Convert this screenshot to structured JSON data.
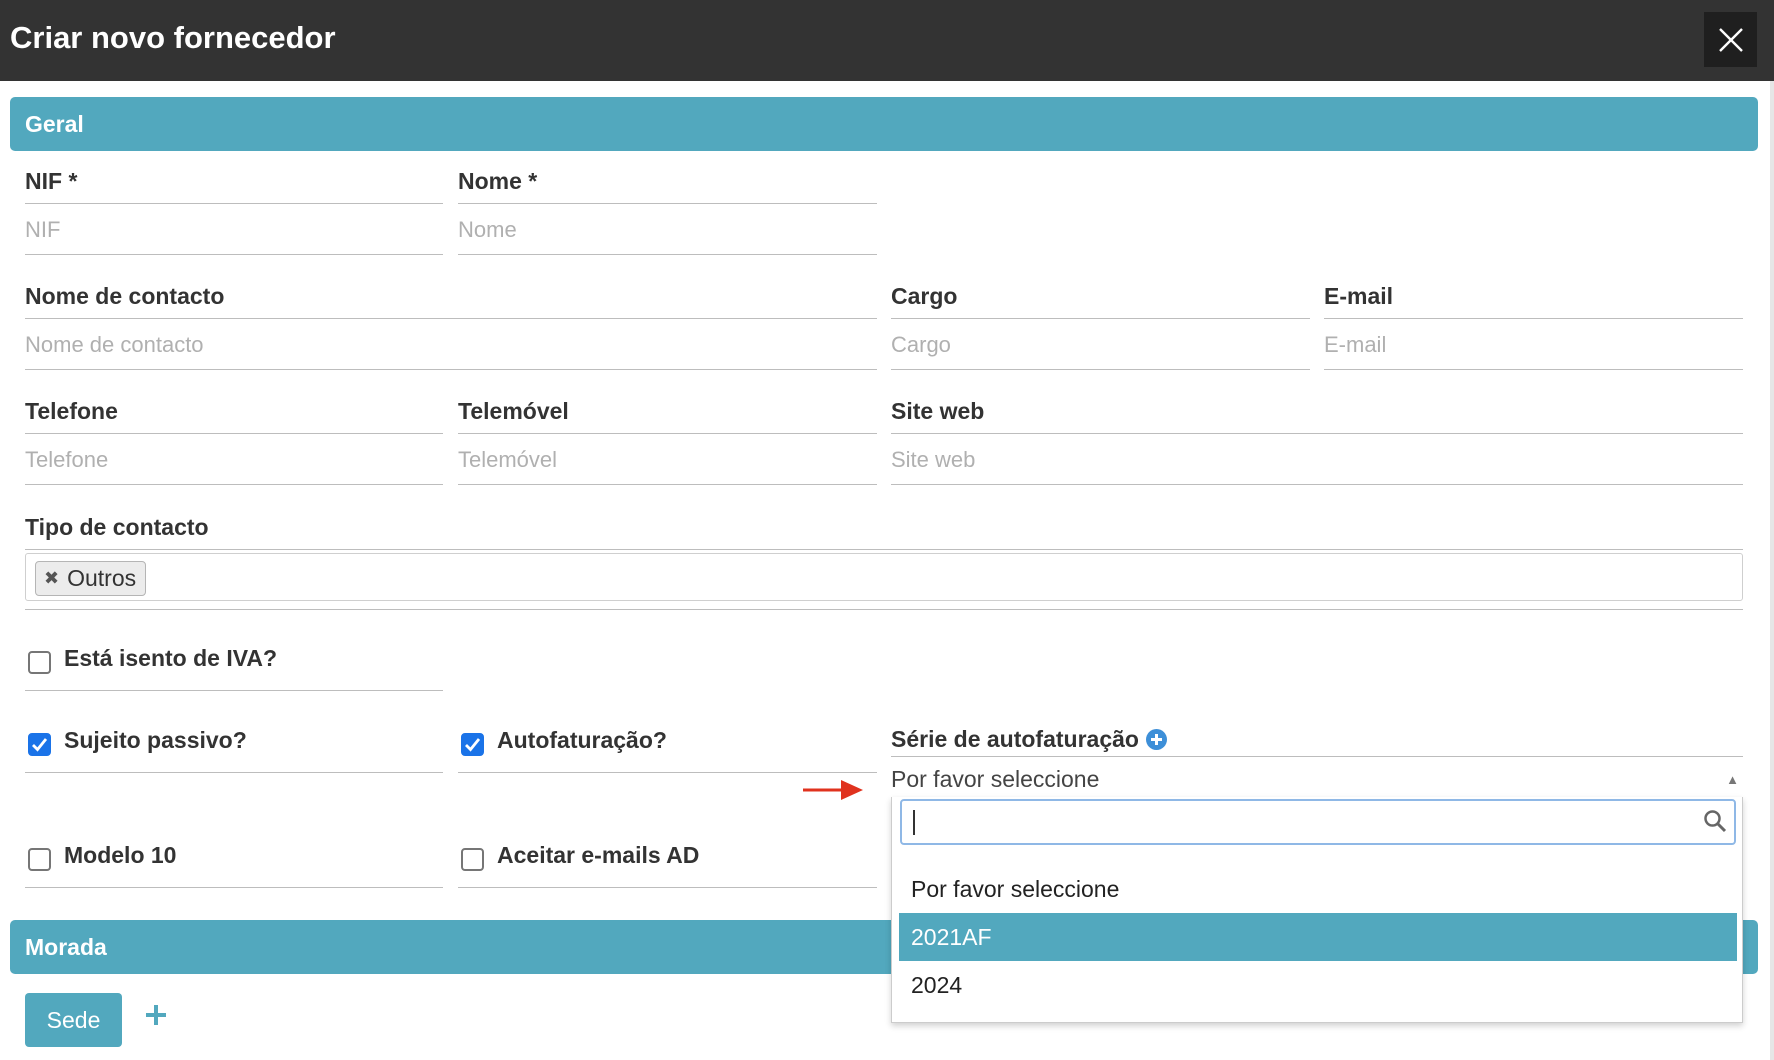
{
  "window": {
    "title": "Criar novo fornecedor"
  },
  "sections": {
    "geral": "Geral",
    "morada": "Morada"
  },
  "fields": {
    "nif": {
      "label": "NIF *",
      "placeholder": "NIF",
      "value": ""
    },
    "nome": {
      "label": "Nome *",
      "placeholder": "Nome",
      "value": ""
    },
    "nome_contacto": {
      "label": "Nome de contacto",
      "placeholder": "Nome de contacto",
      "value": ""
    },
    "cargo": {
      "label": "Cargo",
      "placeholder": "Cargo",
      "value": ""
    },
    "email": {
      "label": "E-mail",
      "placeholder": "E-mail",
      "value": ""
    },
    "telefone": {
      "label": "Telefone",
      "placeholder": "Telefone",
      "value": ""
    },
    "telemovel": {
      "label": "Telemóvel",
      "placeholder": "Telemóvel",
      "value": ""
    },
    "site_web": {
      "label": "Site web",
      "placeholder": "Site web",
      "value": ""
    }
  },
  "tipo_contacto": {
    "label": "Tipo de contacto",
    "tags": [
      "Outros"
    ]
  },
  "checkboxes": {
    "isento_iva": {
      "label": "Está isento de IVA?",
      "checked": false
    },
    "sujeito_passivo": {
      "label": "Sujeito passivo?",
      "checked": true
    },
    "autofaturacao": {
      "label": "Autofaturação?",
      "checked": true
    },
    "modelo10": {
      "label": "Modelo 10",
      "checked": false
    },
    "aceitar_emails": {
      "label": "Aceitar e-mails AD",
      "checked": false
    }
  },
  "serie": {
    "label": "Série de autofaturação",
    "selected": "Por favor seleccione",
    "search_value": "",
    "options": [
      "Por favor seleccione",
      "2021AF",
      "2024"
    ],
    "highlighted_option": "2021AF"
  },
  "morada": {
    "tab_label": "Sede"
  },
  "colors": {
    "titlebar": "#333333",
    "section": "#52a8be",
    "checkbox_on": "#1a73e8",
    "arrow": "#e0321e"
  },
  "icons": {
    "close": "close-icon",
    "search": "search-icon",
    "add_serie": "plus-circle-icon",
    "add_morada": "plus-icon",
    "remove_tag": "remove-tag-icon",
    "dropdown_arrow": "caret-up-icon",
    "annotation_arrow": "red-arrow-icon"
  }
}
